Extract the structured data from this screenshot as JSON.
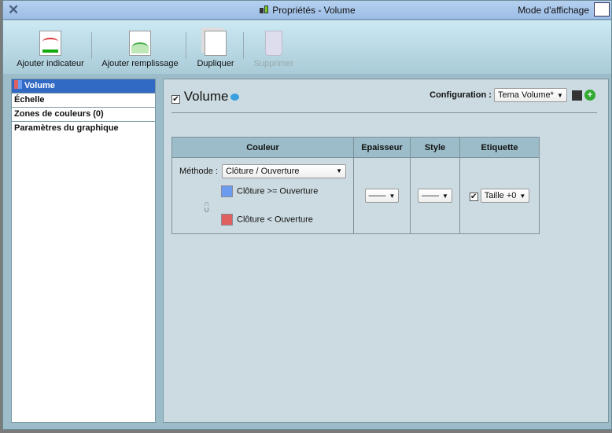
{
  "window": {
    "title": "Propriétés - Volume",
    "mode_label": "Mode d'affichage"
  },
  "toolbar": {
    "add_indicator": "Ajouter indicateur",
    "add_fill": "Ajouter remplissage",
    "duplicate": "Dupliquer",
    "delete": "Supprimer"
  },
  "sidebar": {
    "items": [
      {
        "label": "Volume"
      },
      {
        "label": "Échelle"
      },
      {
        "label": "Zones de couleurs (0)"
      },
      {
        "label": "Paramètres du graphique"
      }
    ]
  },
  "panel": {
    "title": "Volume",
    "config_label": "Configuration :",
    "config_value": "Tema Volume*",
    "columns": [
      "Couleur",
      "Epaisseur",
      "Style",
      "Etiquette"
    ],
    "method_label": "Méthode :",
    "method_value": "Clôture / Ouverture",
    "colors": [
      {
        "label": "Clôture >= Ouverture",
        "color": "#6b9cf0"
      },
      {
        "label": "Clôture < Ouverture",
        "color": "#e06060"
      }
    ],
    "thickness_value": "——",
    "style_value": "——",
    "label_size": "Taille +0"
  }
}
